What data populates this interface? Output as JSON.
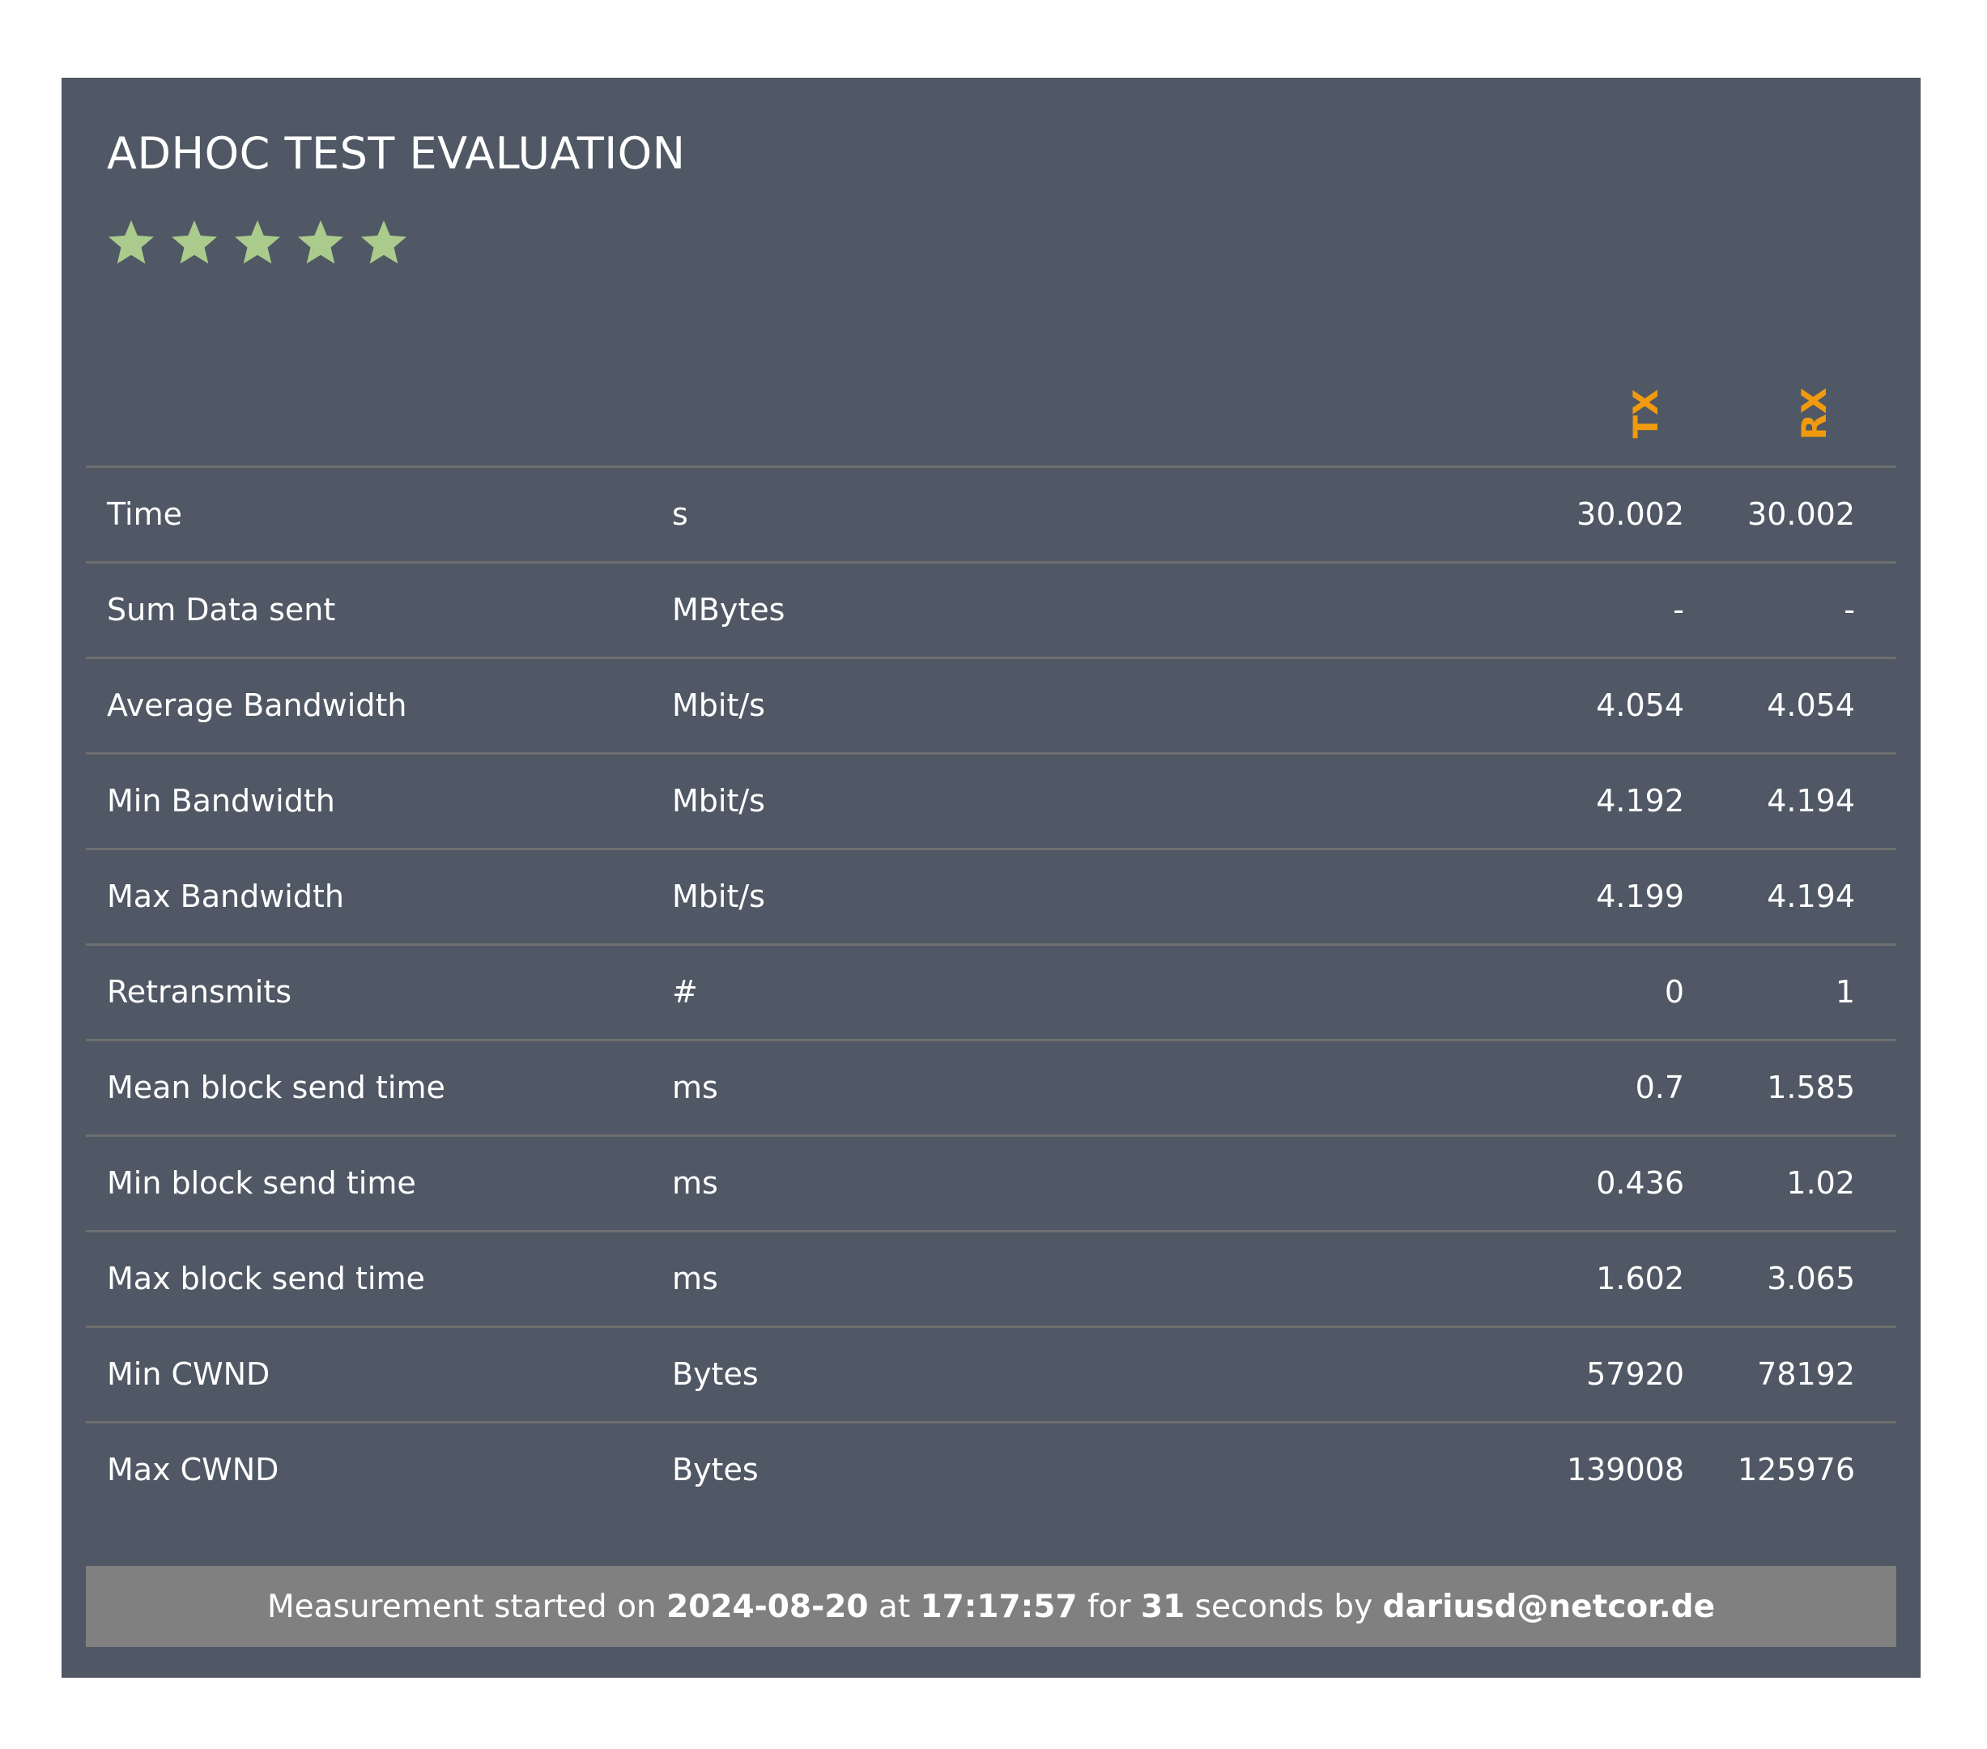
{
  "title": "ADHOC TEST EVALUATION",
  "rating": {
    "value": 5,
    "max": 5,
    "color": "#aacb8c"
  },
  "columns": {
    "tx": "TX",
    "rx": "RX",
    "color": "#f29a0e"
  },
  "rows": [
    {
      "label": "Time",
      "unit": "s",
      "tx": "30.002",
      "rx": "30.002"
    },
    {
      "label": "Sum Data sent",
      "unit": "MBytes",
      "tx": "-",
      "rx": "-"
    },
    {
      "label": "Average Bandwidth",
      "unit": "Mbit/s",
      "tx": "4.054",
      "rx": "4.054"
    },
    {
      "label": "Min Bandwidth",
      "unit": "Mbit/s",
      "tx": "4.192",
      "rx": "4.194"
    },
    {
      "label": "Max Bandwidth",
      "unit": "Mbit/s",
      "tx": "4.199",
      "rx": "4.194"
    },
    {
      "label": "Retransmits",
      "unit": "#",
      "tx": "0",
      "rx": "1"
    },
    {
      "label": "Mean block send time",
      "unit": "ms",
      "tx": "0.7",
      "rx": "1.585"
    },
    {
      "label": "Min block send time",
      "unit": "ms",
      "tx": "0.436",
      "rx": "1.02"
    },
    {
      "label": "Max block send time",
      "unit": "ms",
      "tx": "1.602",
      "rx": "3.065"
    },
    {
      "label": "Min CWND",
      "unit": "Bytes",
      "tx": "57920",
      "rx": "78192"
    },
    {
      "label": "Max CWND",
      "unit": "Bytes",
      "tx": "139008",
      "rx": "125976"
    }
  ],
  "footer": {
    "prefix": "Measurement started on ",
    "date": "2024-08-20",
    "at": " at ",
    "time": "17:17:57",
    "for": " for ",
    "duration": "31",
    "by": " seconds by ",
    "user": "dariusd@netcor.de"
  },
  "colors": {
    "card_background": "#4f5864",
    "footer_background": "#808080",
    "divider": "#6e6f70"
  }
}
